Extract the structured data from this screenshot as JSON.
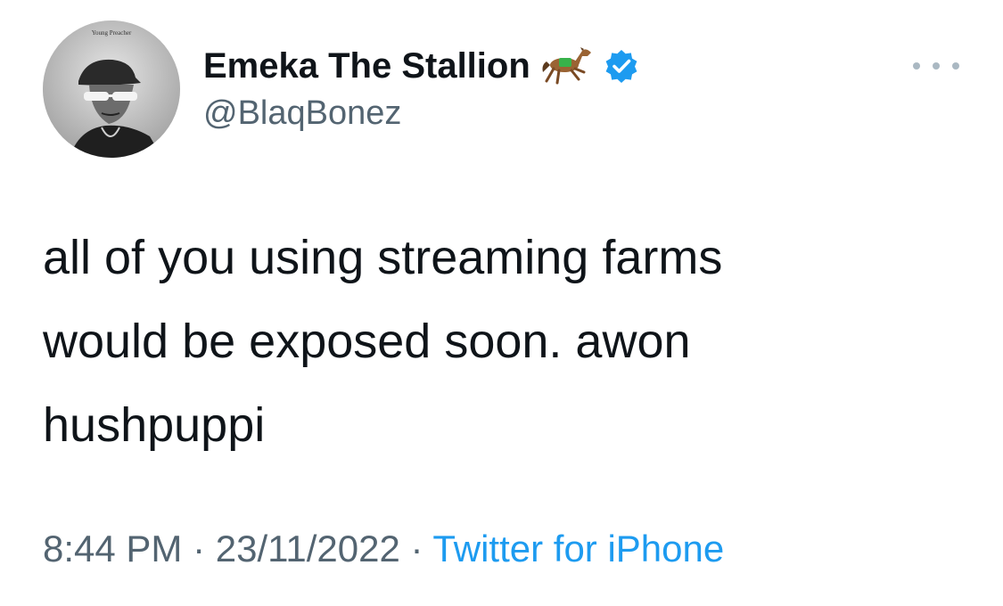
{
  "author": {
    "display_name": "Emeka The Stallion",
    "handle": "@BlaqBonez",
    "name_emoji_icon": "horse-icon",
    "verified_icon": "verified-badge-icon",
    "avatar_caption": "Young Preacher"
  },
  "tweet": {
    "text_lines": [
      "all of you using streaming farms",
      "would be exposed soon. awon",
      "hushpuppi"
    ]
  },
  "meta": {
    "time": "8:44 PM",
    "separator": " · ",
    "date": "23/11/2022",
    "source": "Twitter for iPhone"
  },
  "colors": {
    "text_primary": "#0f1419",
    "text_secondary": "#536471",
    "link_blue": "#1d9bf0",
    "verified_blue": "#1d9bf0"
  }
}
